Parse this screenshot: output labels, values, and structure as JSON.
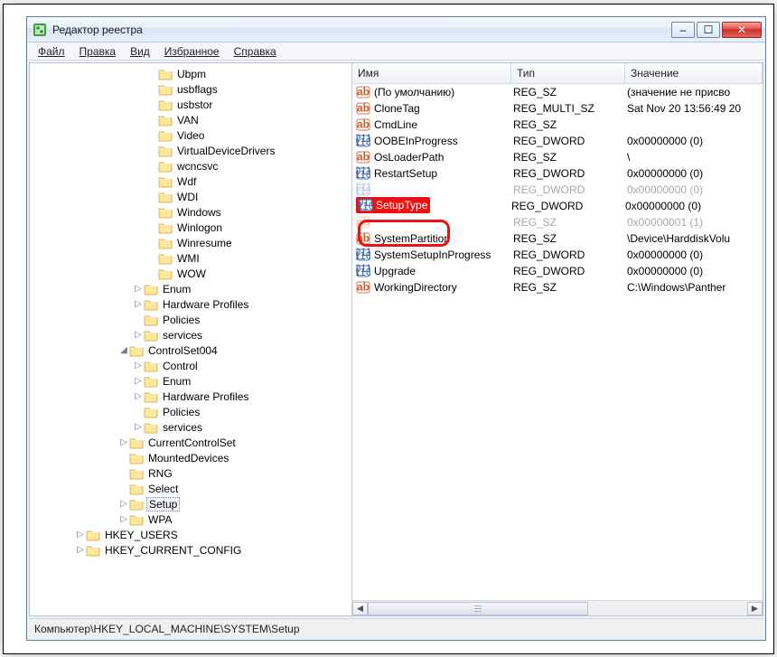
{
  "window": {
    "title": "Редактор реестра"
  },
  "menu": {
    "file": "Файл",
    "edit": "Правка",
    "view": "Вид",
    "favorites": "Избранное",
    "help": "Справка"
  },
  "columns": {
    "name": "Имя",
    "type": "Тип",
    "value": "Значение"
  },
  "tree": {
    "items": [
      {
        "depth": 8,
        "tw": "",
        "label": "Ubpm"
      },
      {
        "depth": 8,
        "tw": "",
        "label": "usbflags"
      },
      {
        "depth": 8,
        "tw": "",
        "label": "usbstor"
      },
      {
        "depth": 8,
        "tw": "",
        "label": "VAN"
      },
      {
        "depth": 8,
        "tw": "",
        "label": "Video"
      },
      {
        "depth": 8,
        "tw": "",
        "label": "VirtualDeviceDrivers"
      },
      {
        "depth": 8,
        "tw": "",
        "label": "wcncsvc"
      },
      {
        "depth": 8,
        "tw": "",
        "label": "Wdf"
      },
      {
        "depth": 8,
        "tw": "",
        "label": "WDI"
      },
      {
        "depth": 8,
        "tw": "",
        "label": "Windows"
      },
      {
        "depth": 8,
        "tw": "",
        "label": "Winlogon"
      },
      {
        "depth": 8,
        "tw": "",
        "label": "Winresume"
      },
      {
        "depth": 8,
        "tw": "",
        "label": "WMI"
      },
      {
        "depth": 8,
        "tw": "",
        "label": "WOW"
      },
      {
        "depth": 7,
        "tw": "▷",
        "label": "Enum"
      },
      {
        "depth": 7,
        "tw": "▷",
        "label": "Hardware Profiles"
      },
      {
        "depth": 7,
        "tw": "",
        "label": "Policies"
      },
      {
        "depth": 7,
        "tw": "▷",
        "label": "services"
      },
      {
        "depth": 6,
        "tw": "◢",
        "label": "ControlSet004"
      },
      {
        "depth": 7,
        "tw": "▷",
        "label": "Control"
      },
      {
        "depth": 7,
        "tw": "▷",
        "label": "Enum"
      },
      {
        "depth": 7,
        "tw": "▷",
        "label": "Hardware Profiles"
      },
      {
        "depth": 7,
        "tw": "",
        "label": "Policies"
      },
      {
        "depth": 7,
        "tw": "▷",
        "label": "services"
      },
      {
        "depth": 6,
        "tw": "▷",
        "label": "CurrentControlSet"
      },
      {
        "depth": 6,
        "tw": "",
        "label": "MountedDevices"
      },
      {
        "depth": 6,
        "tw": "",
        "label": "RNG"
      },
      {
        "depth": 6,
        "tw": "",
        "label": "Select"
      },
      {
        "depth": 6,
        "tw": "▷",
        "label": "Setup",
        "sel": true
      },
      {
        "depth": 6,
        "tw": "▷",
        "label": "WPA"
      },
      {
        "depth": 3,
        "tw": "▷",
        "label": "HKEY_USERS"
      },
      {
        "depth": 3,
        "tw": "▷",
        "label": "HKEY_CURRENT_CONFIG"
      }
    ]
  },
  "list": {
    "rows": [
      {
        "icon": "sz",
        "name": "(По умолчанию)",
        "type": "REG_SZ",
        "value": "(значение не присво"
      },
      {
        "icon": "sz",
        "name": "CloneTag",
        "type": "REG_MULTI_SZ",
        "value": "Sat Nov 20 13:56:49 20"
      },
      {
        "icon": "sz",
        "name": "CmdLine",
        "type": "REG_SZ",
        "value": ""
      },
      {
        "icon": "dw",
        "name": "OOBEInProgress",
        "type": "REG_DWORD",
        "value": "0x00000000 (0)"
      },
      {
        "icon": "sz",
        "name": "OsLoaderPath",
        "type": "REG_SZ",
        "value": "\\"
      },
      {
        "icon": "dw",
        "name": "RestartSetup",
        "type": "REG_DWORD",
        "value": "0x00000000 (0)"
      },
      {
        "icon": "dw",
        "name": "",
        "type": "REG_DWORD",
        "value": "0x00000000 (0)",
        "obscured": true
      },
      {
        "icon": "dw",
        "name": "SetupType",
        "type": "REG_DWORD",
        "value": "0x00000000 (0)",
        "highlight": true
      },
      {
        "icon": "sz",
        "name": "",
        "type": "REG_SZ",
        "value": "0x00000001 (1)",
        "obscured": true
      },
      {
        "icon": "sz",
        "name": "SystemPartition",
        "type": "REG_SZ",
        "value": "\\Device\\HarddiskVolu"
      },
      {
        "icon": "dw",
        "name": "SystemSetupInProgress",
        "type": "REG_DWORD",
        "value": "0x00000000 (0)"
      },
      {
        "icon": "dw",
        "name": "Upgrade",
        "type": "REG_DWORD",
        "value": "0x00000000 (0)"
      },
      {
        "icon": "sz",
        "name": "WorkingDirectory",
        "type": "REG_SZ",
        "value": "C:\\Windows\\Panther"
      }
    ]
  },
  "status": {
    "path": "Компьютер\\HKEY_LOCAL_MACHINE\\SYSTEM\\Setup"
  },
  "icons": {
    "min": "–",
    "max": "☐",
    "close": "✕",
    "left": "◄",
    "right": "►"
  }
}
